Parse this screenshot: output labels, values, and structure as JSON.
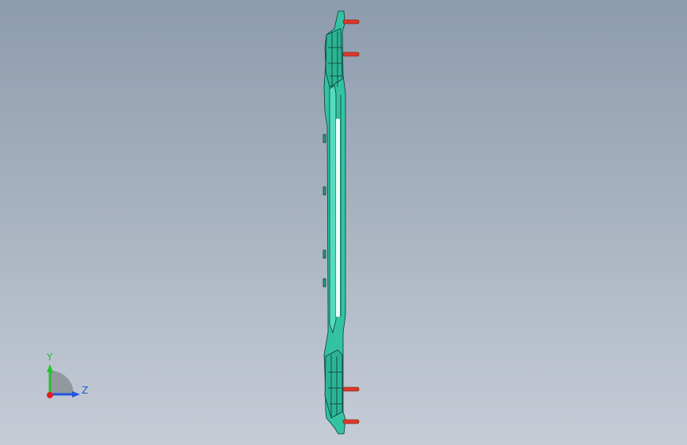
{
  "viewport": {
    "background_top": "#8d9cae",
    "background_bottom": "#c6ccd6"
  },
  "model": {
    "part_color": "#36c8a8",
    "part_edge_color": "#0d3a33",
    "pin_color": "#d83a2a",
    "pin_count": 4
  },
  "triad": {
    "y_label": "Y",
    "z_label": "Z",
    "y_color": "#22c22a",
    "z_color": "#2255e0",
    "x_color": "#e02020",
    "icons": [
      "y-axis-arrow-icon",
      "z-axis-arrow-icon",
      "x-axis-origin-icon"
    ]
  }
}
